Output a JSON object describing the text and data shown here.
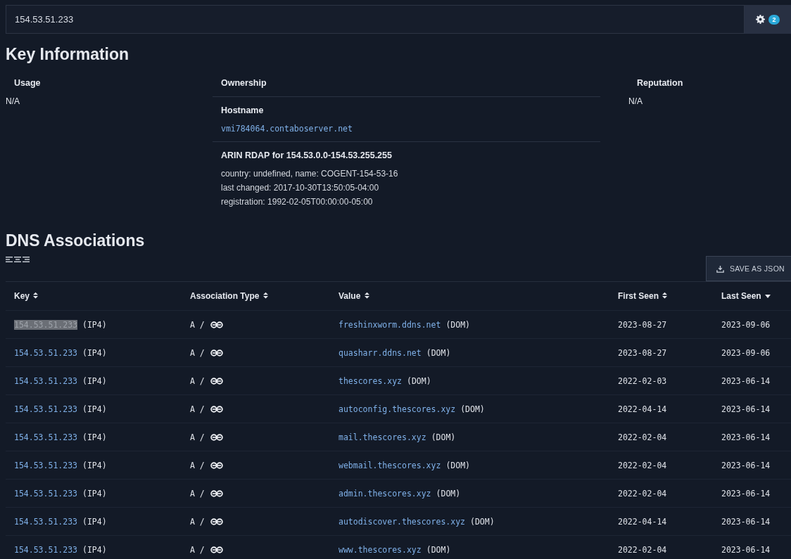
{
  "search": {
    "value": "154.53.51.233",
    "settings_badge": "2"
  },
  "key_information": {
    "title": "Key Information",
    "usage": {
      "label": "Usage",
      "value": "N/A"
    },
    "ownership": {
      "label": "Ownership",
      "sections": [
        {
          "heading": "Hostname",
          "lines": [
            "vmi784064.contaboserver.net"
          ],
          "kind": "link"
        },
        {
          "heading": "ARIN RDAP for 154.53.0.0-154.53.255.255",
          "lines": [
            "country: undefined, name: COGENT-154-53-16",
            "last changed: 2017-10-30T13:50:05-04:00",
            "registration: 1992-02-05T00:00:00-05:00"
          ],
          "kind": "text"
        }
      ]
    },
    "reputation": {
      "label": "Reputation",
      "value": "N/A"
    }
  },
  "dns": {
    "title": "DNS Associations",
    "save_button": "SAVE AS JSON",
    "columns": [
      {
        "label": "Key",
        "sorted_descending": false
      },
      {
        "label": "Association Type",
        "sorted_descending": false
      },
      {
        "label": "Value",
        "sorted_descending": false
      },
      {
        "label": "First Seen",
        "sorted_descending": false
      },
      {
        "label": "Last Seen",
        "sorted_descending": true
      }
    ],
    "rows": [
      {
        "key": "154.53.51.233",
        "key_type": "(IP4)",
        "key_highlighted": true,
        "assoc": "A /",
        "value": "freshinxworm.ddns.net",
        "value_type": "(DOM)",
        "first_seen": "2023-08-27",
        "last_seen": "2023-09-06"
      },
      {
        "key": "154.53.51.233",
        "key_type": "(IP4)",
        "key_highlighted": false,
        "assoc": "A /",
        "value": "quasharr.ddns.net",
        "value_type": "(DOM)",
        "first_seen": "2023-08-27",
        "last_seen": "2023-09-06"
      },
      {
        "key": "154.53.51.233",
        "key_type": "(IP4)",
        "key_highlighted": false,
        "assoc": "A /",
        "value": "thescores.xyz",
        "value_type": "(DOM)",
        "first_seen": "2022-02-03",
        "last_seen": "2023-06-14"
      },
      {
        "key": "154.53.51.233",
        "key_type": "(IP4)",
        "key_highlighted": false,
        "assoc": "A /",
        "value": "autoconfig.thescores.xyz",
        "value_type": "(DOM)",
        "first_seen": "2022-04-14",
        "last_seen": "2023-06-14"
      },
      {
        "key": "154.53.51.233",
        "key_type": "(IP4)",
        "key_highlighted": false,
        "assoc": "A /",
        "value": "mail.thescores.xyz",
        "value_type": "(DOM)",
        "first_seen": "2022-02-04",
        "last_seen": "2023-06-14"
      },
      {
        "key": "154.53.51.233",
        "key_type": "(IP4)",
        "key_highlighted": false,
        "assoc": "A /",
        "value": "webmail.thescores.xyz",
        "value_type": "(DOM)",
        "first_seen": "2022-02-04",
        "last_seen": "2023-06-14"
      },
      {
        "key": "154.53.51.233",
        "key_type": "(IP4)",
        "key_highlighted": false,
        "assoc": "A /",
        "value": "admin.thescores.xyz",
        "value_type": "(DOM)",
        "first_seen": "2022-02-04",
        "last_seen": "2023-06-14"
      },
      {
        "key": "154.53.51.233",
        "key_type": "(IP4)",
        "key_highlighted": false,
        "assoc": "A /",
        "value": "autodiscover.thescores.xyz",
        "value_type": "(DOM)",
        "first_seen": "2022-04-14",
        "last_seen": "2023-06-14"
      },
      {
        "key": "154.53.51.233",
        "key_type": "(IP4)",
        "key_highlighted": false,
        "assoc": "A /",
        "value": "www.thescores.xyz",
        "value_type": "(DOM)",
        "first_seen": "2022-02-04",
        "last_seen": "2023-06-14"
      }
    ]
  }
}
